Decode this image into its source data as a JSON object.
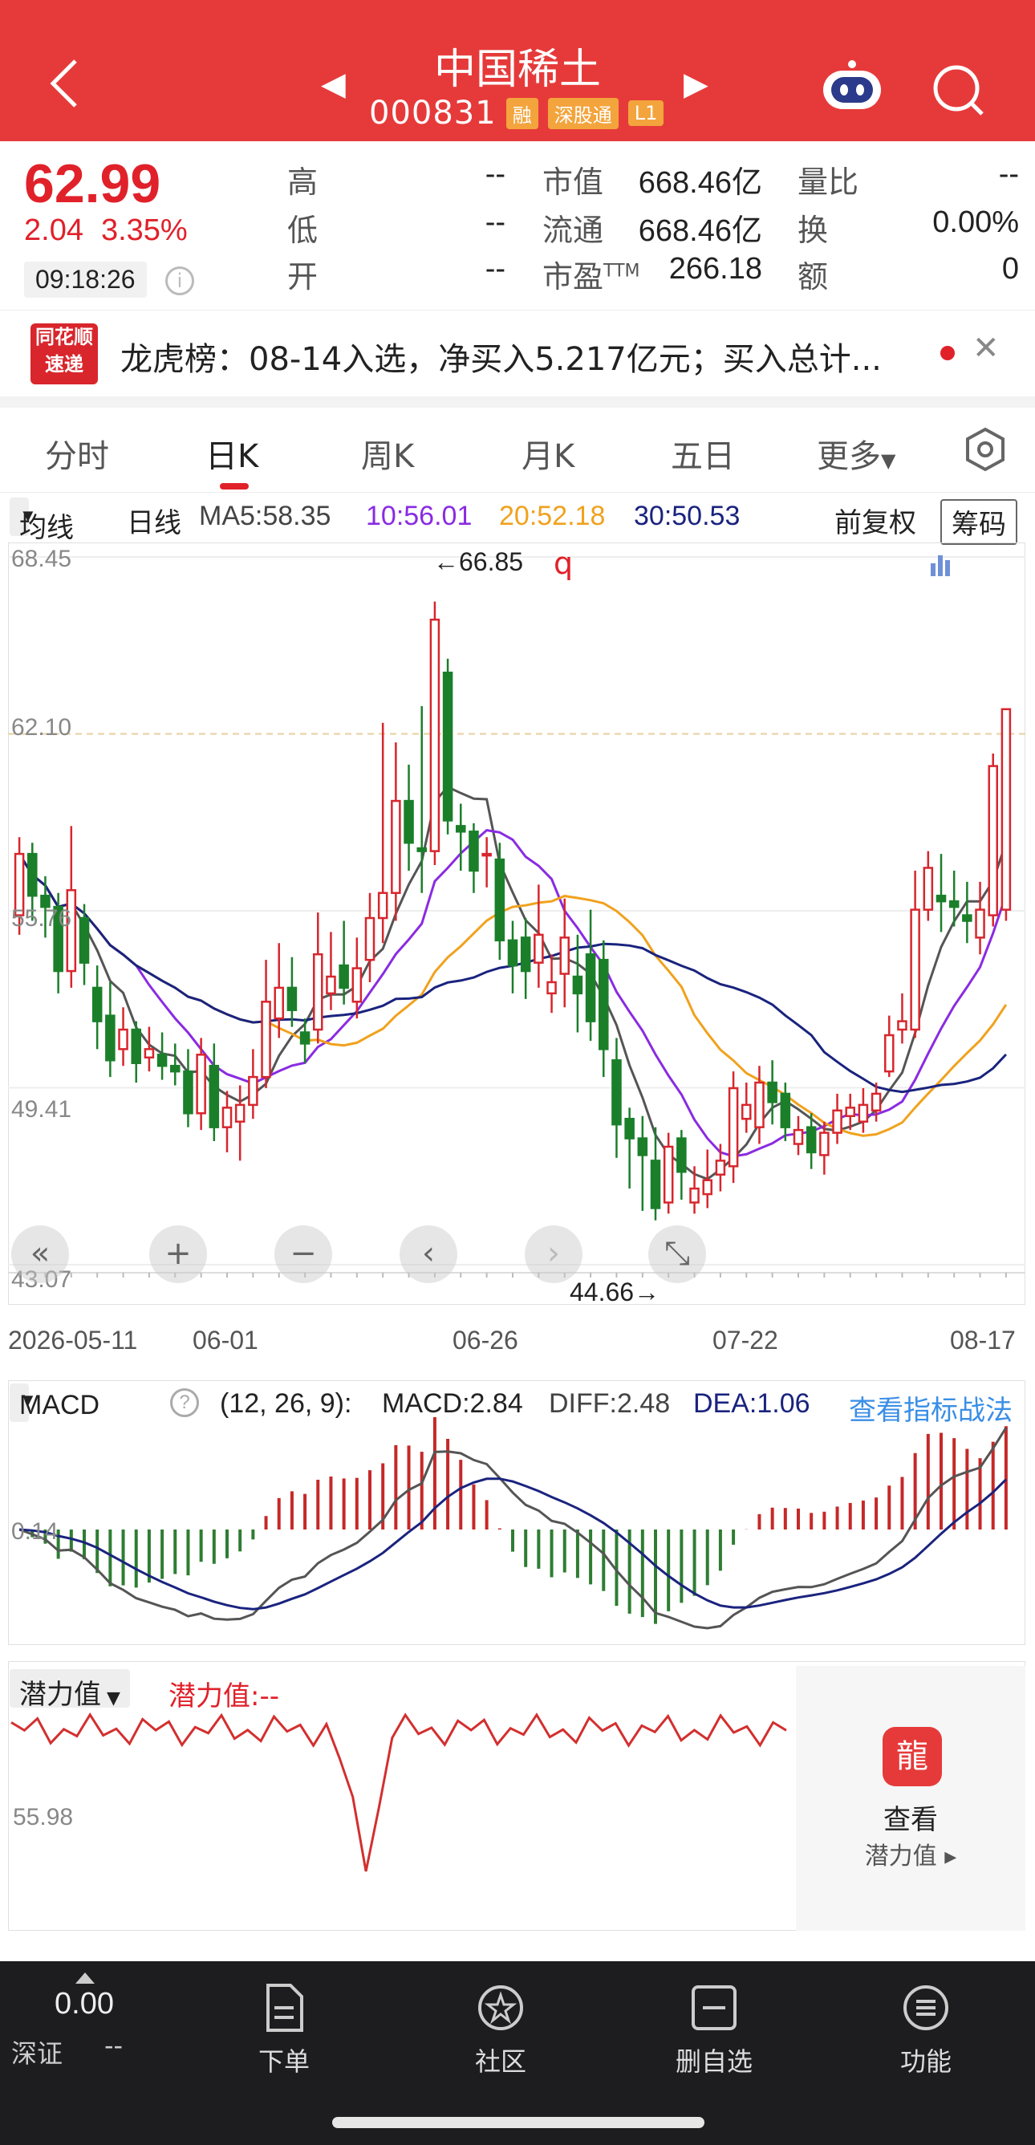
{
  "header": {
    "title": "中国稀土",
    "code": "000831",
    "tags": [
      "融",
      "深股通",
      "L1"
    ],
    "bg": "#e63a3a"
  },
  "quote": {
    "price": "62.99",
    "change": "2.04",
    "change_pct": "3.35%",
    "time": "09:18:26",
    "rows": [
      {
        "label": "高",
        "value": "--",
        "label2": "市值",
        "value2": "668.46亿",
        "label3": "量比",
        "value3": "--"
      },
      {
        "label": "低",
        "value": "--",
        "label2": "流通",
        "value2": "668.46亿",
        "label3": "换",
        "value3": "0.00%"
      },
      {
        "label": "开",
        "value": "--",
        "label2": "市盈",
        "sup2": "TTM",
        "value2": "266.18",
        "label3": "额",
        "value3": "0"
      }
    ]
  },
  "news": {
    "logo_line1": "同花顺",
    "logo_line2": "速递",
    "text": "龙虎榜：08-14入选，净买入5.217亿元；买入总计..."
  },
  "tabs": [
    {
      "label": "分时"
    },
    {
      "label": "日K"
    },
    {
      "label": "周K"
    },
    {
      "label": "月K"
    },
    {
      "label": "五日"
    },
    {
      "label": "更多"
    }
  ],
  "ma": {
    "selector": "均线",
    "period": "日线",
    "ma5": "MA5:58.35",
    "ma10": "10:56.01",
    "ma20": "20:52.18",
    "ma30": "30:50.53",
    "adjust": "前复权",
    "chip": "筹码"
  },
  "kchart": {
    "y_labels": [
      "68.45",
      "62.10",
      "55.76",
      "49.41",
      "43.07"
    ],
    "high_note": "←66.85",
    "low_note": "44.66→",
    "dates": [
      "2026-05-11",
      "06-01",
      "06-26",
      "07-22",
      "08-17"
    ],
    "colors": {
      "up": "#d7262d",
      "down": "#1b7f2a",
      "ma5": "#555555",
      "ma10": "#8a2be2",
      "ma20": "#f0a21e",
      "ma30": "#1a237e"
    }
  },
  "controls": [
    "«",
    "+",
    "−",
    "‹",
    "›"
  ],
  "macd": {
    "selector": "MACD",
    "params": "(12, 26, 9):",
    "macd": "MACD:2.84",
    "diff": "DIFF:2.48",
    "dea": "DEA:1.06",
    "link": "查看指标战法",
    "y_label": "0.14"
  },
  "potential": {
    "selector": "潜力值",
    "value": "潜力值:--",
    "y_label": "55.98",
    "card_title": "查看",
    "card_sub": "潜力值 ▸"
  },
  "bottom": {
    "index_value": "0.00",
    "index_name": "深证",
    "index_change": "--",
    "nav": [
      "下单",
      "社区",
      "删自选",
      "功能"
    ]
  },
  "chart_data": {
    "type": "candlestick",
    "candles": [
      {
        "o": 55.6,
        "c": 57.8,
        "h": 58.4,
        "l": 54.9
      },
      {
        "o": 57.8,
        "c": 56.3,
        "h": 58.2,
        "l": 55.4
      },
      {
        "o": 56.3,
        "c": 55.9,
        "h": 57.0,
        "l": 54.8
      },
      {
        "o": 55.9,
        "c": 53.6,
        "h": 56.4,
        "l": 52.8
      },
      {
        "o": 53.6,
        "c": 56.5,
        "h": 58.8,
        "l": 53.0
      },
      {
        "o": 55.5,
        "c": 53.9,
        "h": 56.0,
        "l": 53.1
      },
      {
        "o": 53.0,
        "c": 51.8,
        "h": 53.8,
        "l": 50.8
      },
      {
        "o": 52.0,
        "c": 50.4,
        "h": 53.2,
        "l": 49.8
      },
      {
        "o": 50.8,
        "c": 51.5,
        "h": 52.3,
        "l": 50.2
      },
      {
        "o": 51.5,
        "c": 50.3,
        "h": 51.8,
        "l": 49.6
      },
      {
        "o": 50.5,
        "c": 50.8,
        "h": 51.6,
        "l": 50.0
      },
      {
        "o": 50.6,
        "c": 50.2,
        "h": 51.4,
        "l": 49.7
      },
      {
        "o": 50.2,
        "c": 50.0,
        "h": 51.0,
        "l": 49.5
      },
      {
        "o": 50.0,
        "c": 48.5,
        "h": 50.8,
        "l": 48.0
      },
      {
        "o": 48.5,
        "c": 50.6,
        "h": 51.2,
        "l": 47.9
      },
      {
        "o": 50.2,
        "c": 48.0,
        "h": 51.0,
        "l": 47.5
      },
      {
        "o": 48.0,
        "c": 48.7,
        "h": 49.3,
        "l": 47.1
      },
      {
        "o": 48.2,
        "c": 48.8,
        "h": 49.5,
        "l": 46.8
      },
      {
        "o": 48.8,
        "c": 49.8,
        "h": 50.8,
        "l": 48.3
      },
      {
        "o": 49.8,
        "c": 52.5,
        "h": 54.0,
        "l": 49.4
      },
      {
        "o": 51.9,
        "c": 53.0,
        "h": 54.6,
        "l": 51.2
      },
      {
        "o": 53.0,
        "c": 52.2,
        "h": 54.1,
        "l": 51.6
      },
      {
        "o": 51.4,
        "c": 51.0,
        "h": 51.9,
        "l": 50.3
      },
      {
        "o": 51.5,
        "c": 54.2,
        "h": 55.7,
        "l": 51.0
      },
      {
        "o": 52.8,
        "c": 53.4,
        "h": 55.0,
        "l": 52.2
      },
      {
        "o": 53.8,
        "c": 53.0,
        "h": 55.4,
        "l": 52.4
      },
      {
        "o": 52.5,
        "c": 53.7,
        "h": 54.8,
        "l": 51.9
      },
      {
        "o": 54.0,
        "c": 55.5,
        "h": 56.4,
        "l": 53.2
      },
      {
        "o": 55.5,
        "c": 56.4,
        "h": 62.5,
        "l": 54.6
      },
      {
        "o": 56.4,
        "c": 59.7,
        "h": 61.8,
        "l": 55.4
      },
      {
        "o": 59.7,
        "c": 58.2,
        "h": 61.0,
        "l": 57.2
      },
      {
        "o": 58.0,
        "c": 57.9,
        "h": 63.1,
        "l": 56.4
      },
      {
        "o": 57.9,
        "c": 66.2,
        "h": 66.85,
        "l": 57.4
      },
      {
        "o": 64.3,
        "c": 59.0,
        "h": 64.8,
        "l": 58.5
      },
      {
        "o": 58.8,
        "c": 58.6,
        "h": 59.6,
        "l": 57.2
      },
      {
        "o": 58.6,
        "c": 57.2,
        "h": 58.9,
        "l": 56.4
      },
      {
        "o": 57.8,
        "c": 57.8,
        "h": 58.4,
        "l": 56.6
      },
      {
        "o": 57.6,
        "c": 54.7,
        "h": 58.2,
        "l": 54.0
      },
      {
        "o": 54.7,
        "c": 53.8,
        "h": 55.4,
        "l": 52.8
      },
      {
        "o": 54.8,
        "c": 53.6,
        "h": 55.5,
        "l": 52.6
      },
      {
        "o": 53.9,
        "c": 54.9,
        "h": 56.7,
        "l": 53.0
      },
      {
        "o": 52.8,
        "c": 53.2,
        "h": 54.2,
        "l": 52.1
      },
      {
        "o": 53.5,
        "c": 54.8,
        "h": 56.2,
        "l": 52.3
      },
      {
        "o": 53.4,
        "c": 52.8,
        "h": 54.9,
        "l": 51.4
      },
      {
        "o": 54.2,
        "c": 51.8,
        "h": 55.8,
        "l": 51.1
      },
      {
        "o": 54.0,
        "c": 50.8,
        "h": 54.7,
        "l": 49.8
      },
      {
        "o": 50.4,
        "c": 48.1,
        "h": 51.2,
        "l": 46.9
      },
      {
        "o": 48.3,
        "c": 47.6,
        "h": 48.7,
        "l": 45.8
      },
      {
        "o": 47.6,
        "c": 47.0,
        "h": 48.4,
        "l": 45.0
      },
      {
        "o": 46.8,
        "c": 45.1,
        "h": 48.0,
        "l": 44.66
      },
      {
        "o": 45.3,
        "c": 47.3,
        "h": 47.8,
        "l": 44.9
      },
      {
        "o": 47.6,
        "c": 46.4,
        "h": 47.9,
        "l": 45.4
      },
      {
        "o": 45.3,
        "c": 45.8,
        "h": 46.6,
        "l": 44.9
      },
      {
        "o": 45.6,
        "c": 46.1,
        "h": 47.2,
        "l": 45.1
      },
      {
        "o": 46.3,
        "c": 46.8,
        "h": 47.4,
        "l": 45.7
      },
      {
        "o": 46.6,
        "c": 49.4,
        "h": 50.0,
        "l": 46.0
      },
      {
        "o": 48.3,
        "c": 48.8,
        "h": 49.6,
        "l": 47.8
      },
      {
        "o": 48.0,
        "c": 49.6,
        "h": 50.2,
        "l": 47.4
      },
      {
        "o": 49.6,
        "c": 48.9,
        "h": 50.4,
        "l": 48.1
      },
      {
        "o": 49.2,
        "c": 48.0,
        "h": 49.6,
        "l": 47.5
      },
      {
        "o": 47.4,
        "c": 47.9,
        "h": 48.4,
        "l": 47.0
      },
      {
        "o": 48.0,
        "c": 47.1,
        "h": 48.5,
        "l": 46.5
      },
      {
        "o": 47.0,
        "c": 47.8,
        "h": 48.2,
        "l": 46.3
      },
      {
        "o": 47.8,
        "c": 48.6,
        "h": 49.2,
        "l": 47.4
      },
      {
        "o": 48.4,
        "c": 48.7,
        "h": 49.2,
        "l": 47.9
      },
      {
        "o": 48.2,
        "c": 48.8,
        "h": 49.4,
        "l": 47.8
      },
      {
        "o": 48.6,
        "c": 49.2,
        "h": 49.6,
        "l": 48.2
      },
      {
        "o": 50.0,
        "c": 51.3,
        "h": 52.0,
        "l": 49.8
      },
      {
        "o": 51.5,
        "c": 51.8,
        "h": 52.8,
        "l": 51.0
      },
      {
        "o": 51.5,
        "c": 55.8,
        "h": 57.2,
        "l": 51.2
      },
      {
        "o": 55.8,
        "c": 57.3,
        "h": 57.9,
        "l": 55.4
      },
      {
        "o": 56.3,
        "c": 56.1,
        "h": 57.8,
        "l": 55.0
      },
      {
        "o": 56.1,
        "c": 55.9,
        "h": 57.2,
        "l": 55.2
      },
      {
        "o": 55.6,
        "c": 55.4,
        "h": 56.8,
        "l": 54.6
      },
      {
        "o": 54.8,
        "c": 55.8,
        "h": 56.8,
        "l": 54.2
      },
      {
        "o": 55.6,
        "c": 60.95,
        "h": 61.4,
        "l": 55.2
      },
      {
        "o": 55.8,
        "c": 62.99,
        "h": 62.99,
        "l": 55.4
      }
    ],
    "ma": {
      "ma5_end": 58.35,
      "ma10_end": 56.01,
      "ma20_end": 52.18,
      "ma30_end": 50.53
    },
    "ylim": [
      43.07,
      68.45
    ],
    "x_dates": [
      "2026-05-11",
      "06-01",
      "06-26",
      "07-22",
      "08-17"
    ]
  }
}
